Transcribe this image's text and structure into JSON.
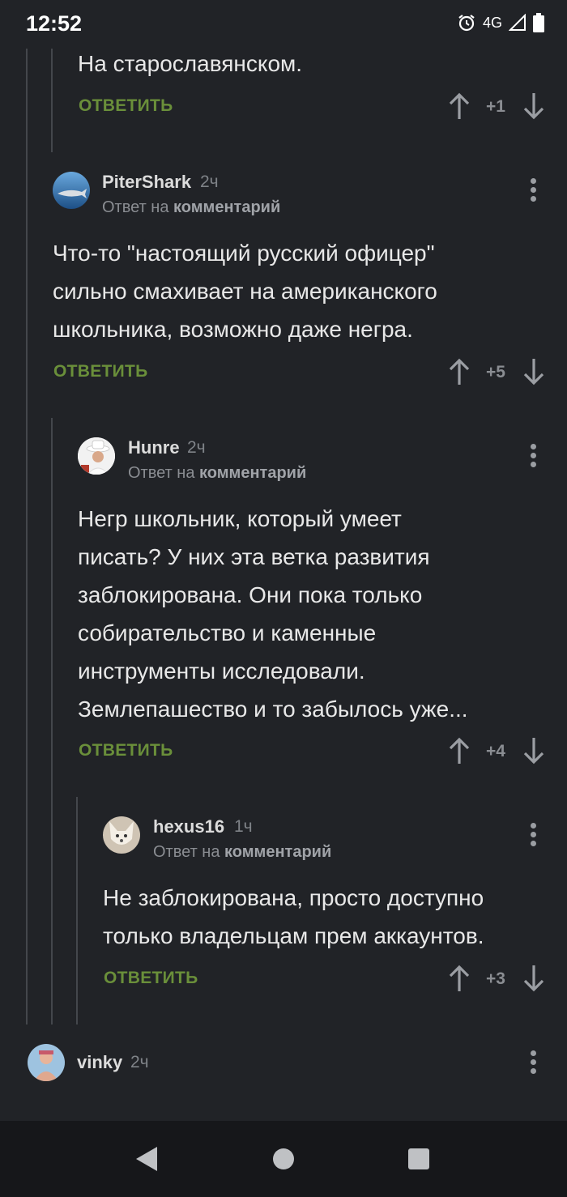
{
  "status_bar": {
    "time": "12:52",
    "network": "4G"
  },
  "comments": [
    {
      "text": "На старославянском.",
      "reply_label": "ОТВЕТИТЬ",
      "score": "+1"
    },
    {
      "username": "PiterShark",
      "time": "2ч",
      "reply_prefix": "Ответ на",
      "reply_target": "комментарий",
      "text": "Что-то \"настоящий русский офицер\"\nсильно смахивает на американского\nшкольника, возможно даже негра.",
      "reply_label": "ОТВЕТИТЬ",
      "score": "+5"
    },
    {
      "username": "Hunre",
      "time": "2ч",
      "reply_prefix": "Ответ на",
      "reply_target": "комментарий",
      "text": "Негр школьник, который умеет\nписать? У них эта ветка развития\nзаблокирована. Они пока только\nсобирательство и каменные\nинструменты исследовали.\nЗемлепашество и то забылось уже...",
      "reply_label": "ОТВЕТИТЬ",
      "score": "+4"
    },
    {
      "username": "hexus16",
      "time": "1ч",
      "reply_prefix": "Ответ на",
      "reply_target": "комментарий",
      "text": "Не заблокирована, просто доступно\nтолько владельцам прем аккаунтов.",
      "reply_label": "ОТВЕТИТЬ",
      "score": "+3"
    },
    {
      "username": "vinky",
      "time": "2ч"
    }
  ],
  "colors": {
    "accent_green": "#6a8f3a",
    "background": "#212327"
  }
}
